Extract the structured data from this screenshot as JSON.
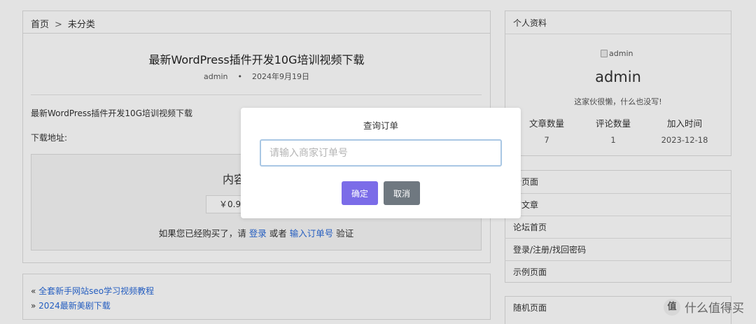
{
  "breadcrumb": {
    "home": "首页",
    "separator": ">",
    "category": "未分类"
  },
  "post": {
    "title": "最新WordPress插件开发10G培训视频下载",
    "author": "admin",
    "meta_dot": "•",
    "date": "2024年9月19日",
    "body_line": "最新WordPress插件开发10G培训视频下载",
    "download_label": "下载地址:",
    "hidden_title": "内容已被隐藏",
    "price": "￥0.99",
    "hint_prefix": "如果您已经购买了，请",
    "hint_login": "登录",
    "hint_or": "或者",
    "hint_order": "输入订单号",
    "hint_suffix": "验证"
  },
  "nav_links": {
    "prev_mark": "«",
    "prev": "全套新手网站seo学习视频教程",
    "next_mark": "»",
    "next": "2024最新美剧下载"
  },
  "profile": {
    "heading": "个人资料",
    "avatar_alt": "admin",
    "name": "admin",
    "signature": "这家伙很懒，什么也没写!",
    "stats": [
      {
        "label": "文章数量",
        "value": "7"
      },
      {
        "label": "评论数量",
        "value": "1"
      },
      {
        "label": "加入时间",
        "value": "2023-12-18"
      }
    ]
  },
  "pages_widget": {
    "heading": "新页面",
    "items": [
      "布文章",
      "论坛首页",
      "登录/注册/找回密码",
      "示例页面"
    ]
  },
  "random_widget": {
    "heading": "随机页面"
  },
  "modal": {
    "title": "查询订单",
    "input_placeholder": "请输入商家订单号",
    "input_value": "",
    "ok_label": "确定",
    "cancel_label": "取消"
  },
  "watermark": {
    "icon": "值",
    "text": "什么值得买"
  },
  "colors": {
    "confirm": "#7b6ce8",
    "cancel": "#6f7880",
    "link": "#2a6ad8",
    "input_border": "#a9c7e4"
  }
}
